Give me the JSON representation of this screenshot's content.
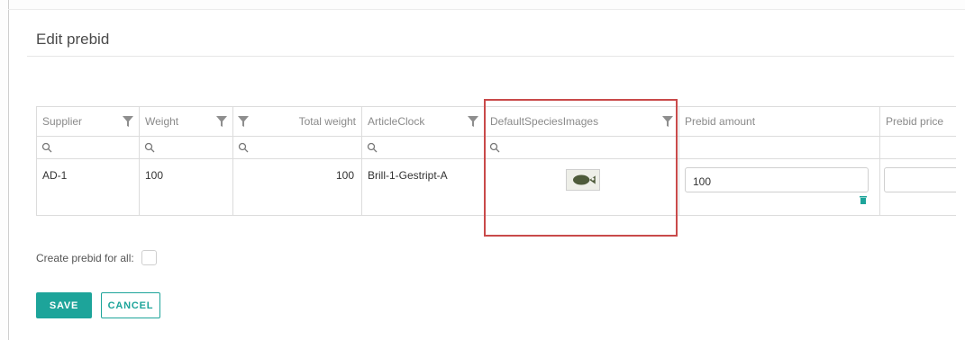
{
  "dialog": {
    "title": "Edit prebid"
  },
  "grid": {
    "columns": [
      {
        "label": "Supplier",
        "filter_icon": "funnel-icon"
      },
      {
        "label": "Weight",
        "filter_icon": "funnel-icon"
      },
      {
        "label": "Total weight",
        "filter_icon": "funnel-icon"
      },
      {
        "label": "ArticleClock",
        "filter_icon": "funnel-icon"
      },
      {
        "label": "DefaultSpeciesImages",
        "filter_icon": "funnel-icon"
      },
      {
        "label": "Prebid amount"
      },
      {
        "label": "Prebid price"
      }
    ],
    "search_icon": "search-icon",
    "rows": [
      {
        "supplier": "AD-1",
        "weight": "100",
        "total_weight": "100",
        "article_clock": "Brill-1-Gestript-A",
        "species_image": "flatfish-image",
        "prebid_amount": "100",
        "prebid_price": ""
      }
    ],
    "row_action_icon": "trash-icon"
  },
  "form": {
    "create_for_all_label": "Create prebid for all:",
    "create_for_all_checked": false
  },
  "actions": {
    "save_label": "SAVE",
    "cancel_label": "CANCEL"
  },
  "colors": {
    "accent": "#1da49a",
    "highlight": "#c94a4a",
    "border": "#dcdcdc"
  }
}
